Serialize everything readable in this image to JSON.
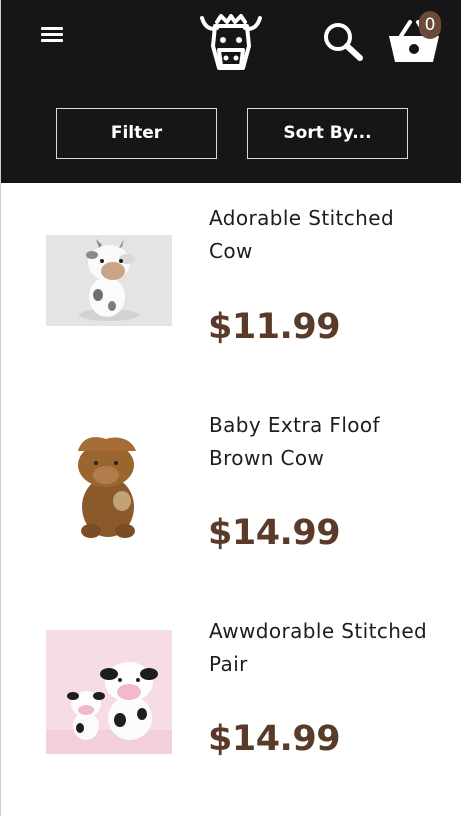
{
  "header": {
    "menu_icon": "hamburger-menu-icon",
    "logo_icon": "cow-head-logo",
    "search_icon": "search-icon",
    "cart_icon": "basket-icon",
    "cart_count": "0",
    "background_color": "#161616"
  },
  "toolbar": {
    "filter_label": "Filter",
    "sort_label": "Sort By..."
  },
  "products": [
    {
      "name": "Adorable Stitched Cow",
      "price": "$11.99",
      "image": "white-crochet-cow-plush"
    },
    {
      "name": "Baby Extra Floof Brown Cow",
      "price": "$14.99",
      "image": "brown-highland-cow-plush"
    },
    {
      "name": "Awwdorable Stitched Pair",
      "price": "$14.99",
      "image": "crochet-cow-pair-on-pink"
    }
  ],
  "colors": {
    "price": "#5a3a29",
    "cart_badge": "#6b4a3c"
  }
}
